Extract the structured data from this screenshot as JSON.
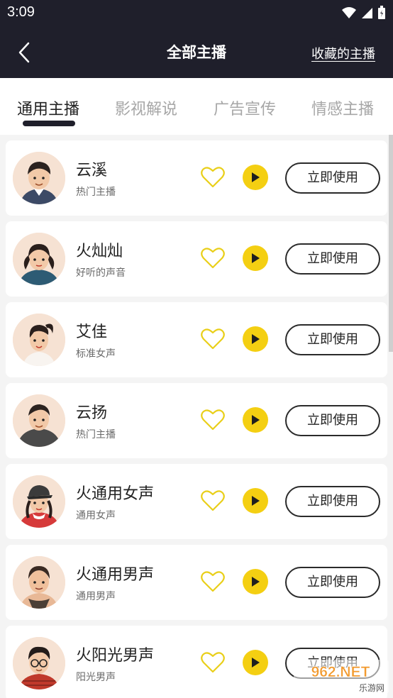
{
  "status": {
    "time": "3:09"
  },
  "header": {
    "title": "全部主播",
    "favorites_link": "收藏的主播"
  },
  "tabs": [
    {
      "label": "通用主播",
      "active": true
    },
    {
      "label": "影视解说",
      "active": false
    },
    {
      "label": "广告宣传",
      "active": false
    },
    {
      "label": "情感主播",
      "active": false
    }
  ],
  "colors": {
    "header_bg": "#1f1f2b",
    "accent": "#f4cf12",
    "heart": "#e9cf19"
  },
  "anchors": [
    {
      "name": "云溪",
      "desc": "热门主播",
      "action": "立即使用",
      "avatar": "boy-avatar-icon"
    },
    {
      "name": "火灿灿",
      "desc": "好听的声音",
      "action": "立即使用",
      "avatar": "girl-pigtails-avatar-icon"
    },
    {
      "name": "艾佳",
      "desc": "标准女声",
      "action": "立即使用",
      "avatar": "girl-ponytail-avatar-icon"
    },
    {
      "name": "云扬",
      "desc": "热门主播",
      "action": "立即使用",
      "avatar": "boy-hoodie-avatar-icon"
    },
    {
      "name": "火通用女声",
      "desc": "通用女声",
      "action": "立即使用",
      "avatar": "girl-cap-avatar-icon"
    },
    {
      "name": "火通用男声",
      "desc": "通用男声",
      "action": "立即使用",
      "avatar": "man-tanktop-avatar-icon"
    },
    {
      "name": "火阳光男声",
      "desc": "阳光男声",
      "action": "立即使用",
      "avatar": "boy-glasses-avatar-icon"
    }
  ],
  "watermark": {
    "brand": "962.NET",
    "site": "乐游网"
  }
}
